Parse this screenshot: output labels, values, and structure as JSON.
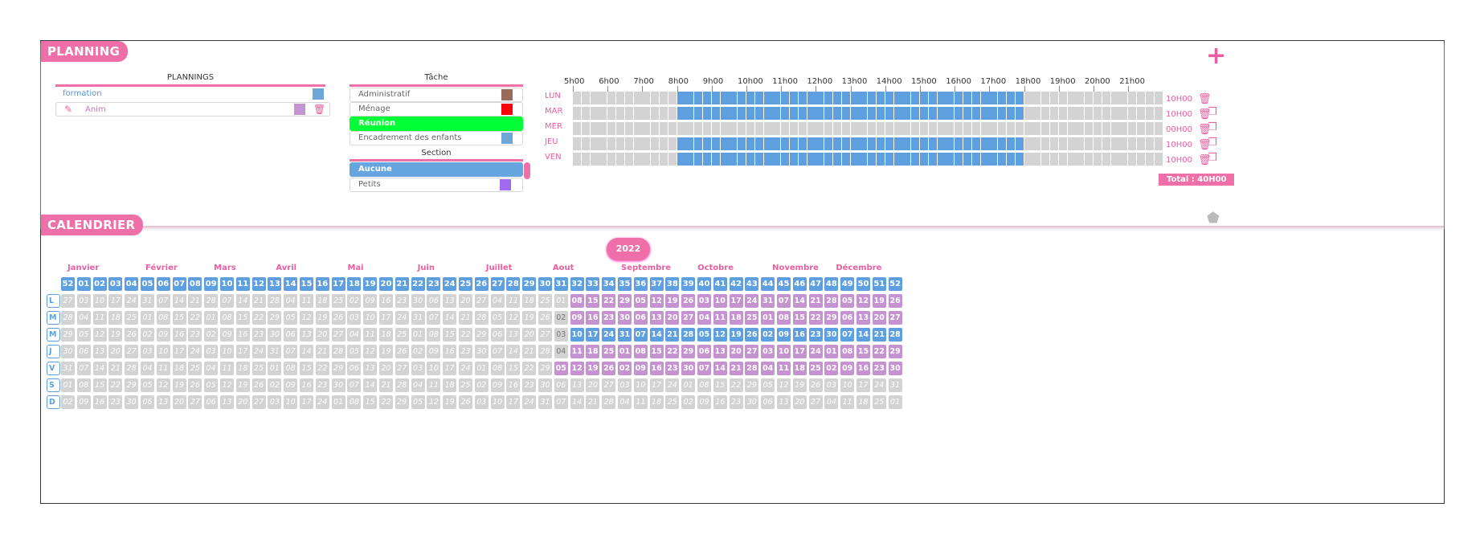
{
  "planning": {
    "title": "PLANNING",
    "plannings_header": "PLANNINGS",
    "plannings": [
      {
        "label": "formation",
        "color": "#6ea6d8"
      },
      {
        "label": "Anim",
        "color": "#c493d0"
      }
    ],
    "tache_header": "Tâche",
    "taches": [
      {
        "label": "Administratif",
        "color": "#9a6b5c"
      },
      {
        "label": "Ménage",
        "color": "#ff0000"
      },
      {
        "label": "Réunion",
        "color": "#00ff37"
      },
      {
        "label": "Encadrement des enfants",
        "color": "#6ea6d8"
      }
    ],
    "section_header": "Section",
    "sections": [
      {
        "label": "Aucune"
      },
      {
        "label": "Petits",
        "color": "#a26aef"
      }
    ],
    "hours": [
      "5h00",
      "6h00",
      "7h00",
      "8h00",
      "9h00",
      "10h00",
      "11h00",
      "12h00",
      "13h00",
      "14h00",
      "15h00",
      "16h00",
      "17h00",
      "18h00",
      "19h00",
      "20h00",
      "21h00"
    ],
    "days": [
      {
        "label": "LUN",
        "duration": "10H00",
        "active": [
          8,
          18
        ],
        "copy": false
      },
      {
        "label": "MAR",
        "duration": "10H00",
        "active": [
          8,
          18
        ],
        "copy": true
      },
      {
        "label": "MER",
        "duration": "00H00",
        "active": null,
        "copy": true
      },
      {
        "label": "JEU",
        "duration": "10H00",
        "active": [
          8,
          18
        ],
        "copy": true
      },
      {
        "label": "VEN",
        "duration": "10H00",
        "active": [
          8,
          18
        ],
        "copy": true
      }
    ],
    "total": "Total : 40H00"
  },
  "calendar": {
    "title": "CALENDRIER",
    "year": "2022",
    "months": [
      "Janvier",
      "Février",
      "Mars",
      "Avril",
      "Mai",
      "Juin",
      "Juillet",
      "Aout",
      "Septembre",
      "Octobre",
      "Novembre",
      "Décembre"
    ],
    "weeks": [
      "52",
      "01",
      "02",
      "03",
      "04",
      "05",
      "06",
      "07",
      "08",
      "09",
      "10",
      "11",
      "12",
      "13",
      "14",
      "15",
      "16",
      "17",
      "18",
      "19",
      "20",
      "21",
      "22",
      "23",
      "24",
      "25",
      "26",
      "27",
      "28",
      "29",
      "30",
      "31",
      "32",
      "33",
      "34",
      "35",
      "36",
      "37",
      "38",
      "39",
      "40",
      "41",
      "42",
      "43",
      "44",
      "45",
      "46",
      "47",
      "48",
      "49",
      "50",
      "51",
      "52"
    ],
    "day_letters": [
      "L",
      "M",
      "M",
      "J",
      "V",
      "S",
      "D"
    ]
  },
  "colors": {
    "accent": "#ef6fa9",
    "blue": "#5e9fe0",
    "purple": "#c493d0",
    "grey": "#d3d3d3"
  }
}
